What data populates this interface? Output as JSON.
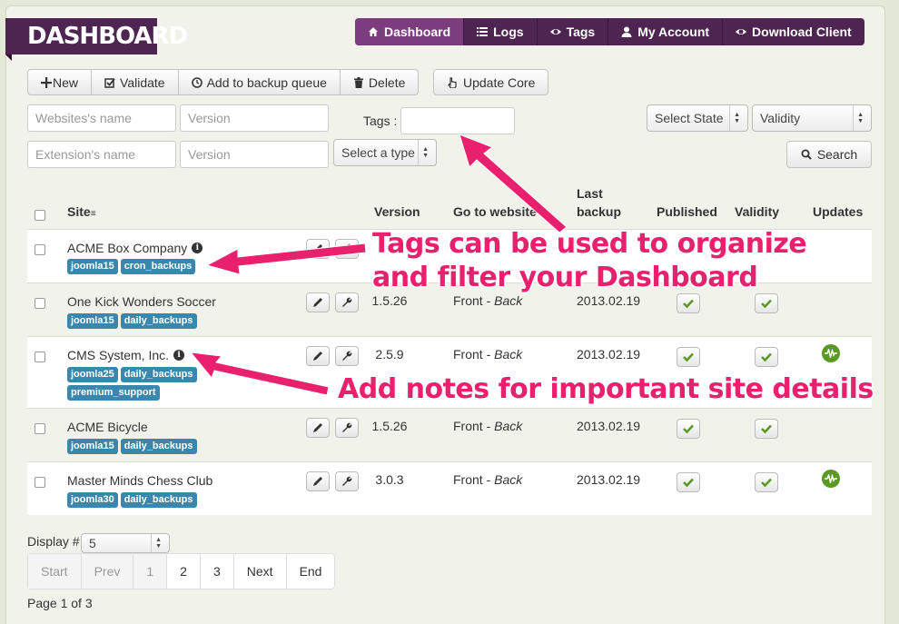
{
  "brand": "DASHBOARD",
  "nav": [
    {
      "label": "Dashboard",
      "icon": "home-icon",
      "active": true
    },
    {
      "label": "Logs",
      "icon": "list-icon"
    },
    {
      "label": "Tags",
      "icon": "eye-icon"
    },
    {
      "label": "My Account",
      "icon": "user-icon"
    },
    {
      "label": "Download Client",
      "icon": "eye-icon"
    }
  ],
  "toolbar": {
    "new": "New",
    "validate": "Validate",
    "backup": "Add to backup queue",
    "delete": "Delete",
    "update_core": "Update Core"
  },
  "filters": {
    "websites_name": "Websites's name",
    "version1": "Version",
    "extension_name": "Extension's name",
    "version2": "Version",
    "select_type": "Select a type",
    "tags_label": "Tags :",
    "select_state": "Select State",
    "validity": "Validity",
    "search": "Search"
  },
  "table": {
    "headers": {
      "site": "Site",
      "version": "Version",
      "go_to_website": "Go to website",
      "last_backup_1": "Last",
      "last_backup_2": "backup",
      "published": "Published",
      "validity": "Validity",
      "updates": "Updates"
    },
    "rows": [
      {
        "name": "ACME Box Company",
        "tags": [
          "joomla15",
          "cron_backups"
        ],
        "version": "",
        "front": "",
        "back": "",
        "date": ""
      },
      {
        "name": "One Kick Wonders Soccer",
        "tags": [
          "joomla15",
          "daily_backups"
        ],
        "version": "1.5.26",
        "front": "Front",
        "back": "Back",
        "date": "2013.02.19"
      },
      {
        "name": "CMS System, Inc.",
        "tags": [
          "joomla25",
          "daily_backups",
          "premium_support"
        ],
        "version": "2.5.9",
        "front": "Front",
        "back": "Back",
        "date": "2013.02.19"
      },
      {
        "name": "ACME Bicycle",
        "tags": [
          "joomla15",
          "daily_backups"
        ],
        "version": "1.5.26",
        "front": "Front",
        "back": "Back",
        "date": "2013.02.19"
      },
      {
        "name": "Master Minds Chess Club",
        "tags": [
          "joomla30",
          "daily_backups"
        ],
        "version": "3.0.3",
        "front": "Front",
        "back": "Back",
        "date": "2013.02.19"
      }
    ],
    "separator": " - "
  },
  "pagination": {
    "display_label": "Display #",
    "display_value": "5",
    "start": "Start",
    "prev": "Prev",
    "pages": [
      "1",
      "2",
      "3"
    ],
    "next": "Next",
    "end": "End",
    "page_of": "Page 1 of 3"
  },
  "annotations": {
    "tags_line1": "Tags can be used to organize",
    "tags_line2": "and filter your Dashboard",
    "notes": "Add notes for important site details"
  },
  "colors": {
    "brand": "#4e2450",
    "nav_active": "#7b3d7d",
    "tag": "#3a87ad",
    "annotation": "#e8206e",
    "update": "#5a9a24"
  }
}
